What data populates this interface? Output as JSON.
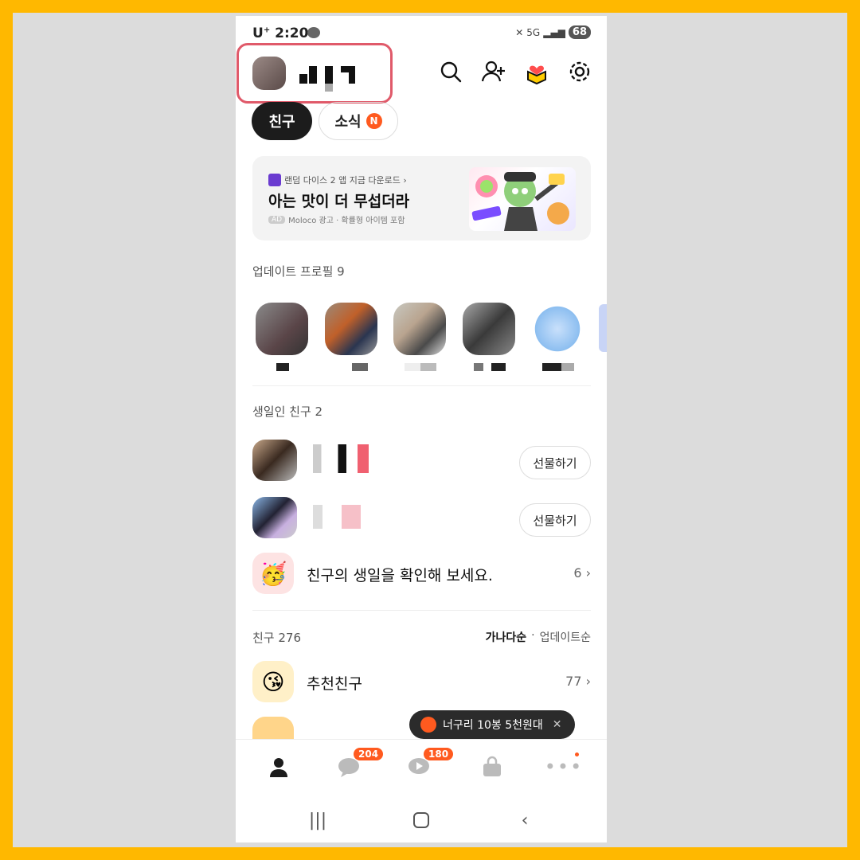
{
  "status": {
    "carrier": "U",
    "time": "2:20",
    "network": "5G",
    "battery": "68"
  },
  "header": {
    "icons": [
      "search-icon",
      "add-friend-icon",
      "gift-icon",
      "settings-icon"
    ]
  },
  "tabs": {
    "friends": "친구",
    "news": "소식",
    "news_badge": "N"
  },
  "ad": {
    "app_line": "랜덤 다이스 2 앱 지금 다운로드 ›",
    "title": "아는 맛이 더 무섭더라",
    "tag": "AD",
    "meta": "Moloco 광고 · 확률형 아이템 포함"
  },
  "updates": {
    "label": "업데이트 프로필 9"
  },
  "birthdays": {
    "label": "생일인 친구 2",
    "gift_label": "선물하기",
    "check_text": "친구의 생일을 확인해 보세요.",
    "check_count": "6"
  },
  "friends": {
    "label": "친구 276",
    "sort_active": "가나다순",
    "sort_inactive": "업데이트순",
    "recommend_text": "추천친구",
    "recommend_count": "77"
  },
  "toast": {
    "text": "너구리 10봉 5천원대"
  },
  "tabbar": {
    "chat_badge": "204",
    "openchat_badge": "180"
  },
  "colors": {
    "accent": "#FF5A1F",
    "frame": "#FFB800",
    "highlight": "#E05A6A"
  }
}
